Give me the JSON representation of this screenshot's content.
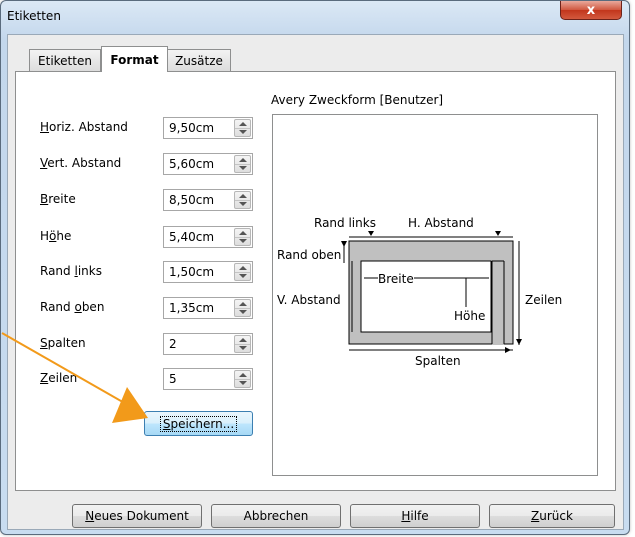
{
  "window": {
    "title": "Etiketten",
    "close_icon_text": "x"
  },
  "tabs": [
    {
      "label": "Etiketten",
      "active": false
    },
    {
      "label": "Format",
      "active": true
    },
    {
      "label": "Zusätze",
      "active": false
    }
  ],
  "fields": [
    {
      "mnemonic": "H",
      "rest": "oriz. Abstand",
      "value": "9,50cm"
    },
    {
      "mnemonic": "V",
      "rest": "ert. Abstand",
      "value": "5,60cm"
    },
    {
      "mnemonic": "B",
      "rest": "reite",
      "value": "8,50cm"
    },
    {
      "pre": "H",
      "mnemonic": "ö",
      "rest": "he",
      "value": "5,40cm"
    },
    {
      "pre": "Rand ",
      "mnemonic": "l",
      "rest": "inks",
      "value": "1,50cm"
    },
    {
      "pre": "Rand ",
      "mnemonic": "o",
      "rest": "ben",
      "value": "1,35cm"
    },
    {
      "mnemonic": "S",
      "rest": "palten",
      "value": "2"
    },
    {
      "mnemonic": "Z",
      "rest": "eilen",
      "value": "5"
    }
  ],
  "save_button": {
    "mnemonic": "S",
    "rest": "peichern..."
  },
  "preview": {
    "title": "Avery Zweckform  [Benutzer]",
    "labels": {
      "rand_links": "Rand links",
      "h_abstand": "H. Abstand",
      "rand_oben": "Rand oben",
      "v_abstand": "V. Abstand",
      "breite": "Breite",
      "hoehe": "Höhe",
      "zeilen": "Zeilen",
      "spalten": "Spalten"
    }
  },
  "footer": {
    "neues_dokument": {
      "mnemonic": "N",
      "rest": "eues Dokument"
    },
    "abbrechen": {
      "label": "Abbrechen"
    },
    "hilfe": {
      "mnemonic": "H",
      "rest": "ilfe"
    },
    "zurueck": {
      "mnemonic": "Z",
      "rest": "urück"
    }
  },
  "colors": {
    "pointer_arrow": "#f29a1a",
    "label_sheet": "#c0c0c0"
  }
}
